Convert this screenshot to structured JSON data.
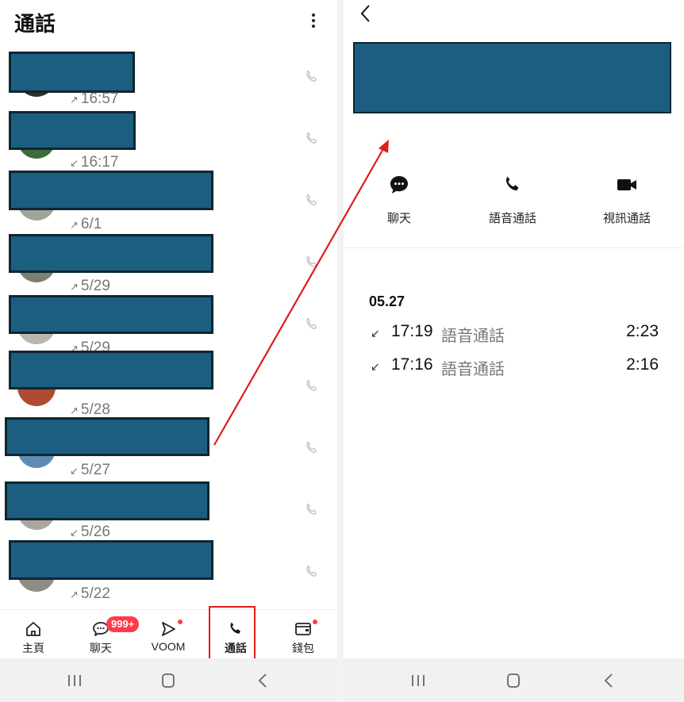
{
  "left": {
    "title": "通話",
    "calls": [
      {
        "dir": "↗",
        "time": "16:57"
      },
      {
        "dir": "↙",
        "time": "16:17"
      },
      {
        "dir": "↗",
        "time": "6/1"
      },
      {
        "dir": "↗",
        "time": "5/29"
      },
      {
        "dir": "↗",
        "time": "5/29"
      },
      {
        "dir": "↗",
        "time": "5/28"
      },
      {
        "dir": "↙",
        "time": "5/27"
      },
      {
        "dir": "↙",
        "time": "5/26"
      },
      {
        "dir": "↗",
        "time": "5/22"
      }
    ],
    "tabs": [
      {
        "label": "主頁",
        "icon": "home-icon"
      },
      {
        "label": "聊天",
        "icon": "chat-icon"
      },
      {
        "label": "VOOM",
        "icon": "voom-icon"
      },
      {
        "label": "通話",
        "icon": "phone-icon"
      },
      {
        "label": "錢包",
        "icon": "wallet-icon"
      }
    ],
    "chat_badge": "999+"
  },
  "right": {
    "actions": [
      {
        "label": "聊天",
        "icon": "chat-bubble-icon"
      },
      {
        "label": "語音通話",
        "icon": "phone-icon"
      },
      {
        "label": "視訊通話",
        "icon": "video-camera-icon"
      }
    ],
    "history": {
      "date": "05.27",
      "entries": [
        {
          "dir": "↙",
          "time": "17:19",
          "kind": "語音通話",
          "duration": "2:23"
        },
        {
          "dir": "↙",
          "time": "17:16",
          "kind": "語音通話",
          "duration": "2:16"
        }
      ]
    }
  },
  "colors": {
    "redaction": "#1b5e80",
    "highlight": "#e21b1b",
    "badge": "#ff3b4b"
  }
}
